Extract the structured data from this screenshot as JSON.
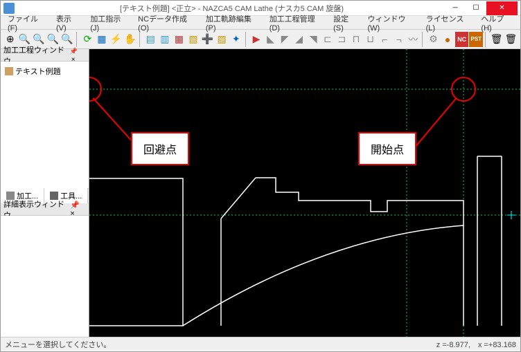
{
  "title": "[テキスト例題] <正立> - NAZCA5 CAM Lathe (ナスカ5 CAM 旋盤)",
  "menu": [
    "ファイル(F)",
    "表示(V)",
    "加工指示(J)",
    "NCデータ作成(O)",
    "加工軌跡編集(P)",
    "加工工程管理(D)",
    "設定(S)",
    "ウィンドウ(W)",
    "ライセンス(L)",
    "ヘルプ(H)"
  ],
  "sidebar": {
    "process_panel": "加工工程ウィンドウ",
    "tree_root": "テキスト例題",
    "tab1": "加工...",
    "tab2": "工具...",
    "detail_panel": "詳細表示ウィンドウ"
  },
  "annotations": {
    "avoid": "回避点",
    "start": "開始点"
  },
  "status": {
    "left": "メニューを選択してください。",
    "right": "z =-8.977,　x =+83.168"
  },
  "icons": {
    "zoom_ext": "⊕",
    "zoom_in": "🔍",
    "zoom_out": "🔍",
    "zoom_fit": "🔍",
    "zoom_win": "🔍",
    "refresh": "⟳",
    "grid": "▦",
    "bolt": "⚡",
    "hand": "✋",
    "lay1": "▤",
    "lay2": "▥",
    "lay3": "▦",
    "lay4": "▧",
    "lay5": "➕",
    "lay6": "▨",
    "pt": "✦",
    "path": "▶",
    "p1": "◣",
    "p2": "◤",
    "p3": "◢",
    "p4": "◥",
    "p5": "⊏",
    "p6": "⊐",
    "p7": "⊓",
    "p8": "⊔",
    "p9": "⌐",
    "p10": "¬",
    "wave": "〰",
    "gear": "⚙",
    "ball": "●",
    "nc": "NC",
    "pst": "PST",
    "can1": "🗑",
    "can2": "🗑"
  }
}
